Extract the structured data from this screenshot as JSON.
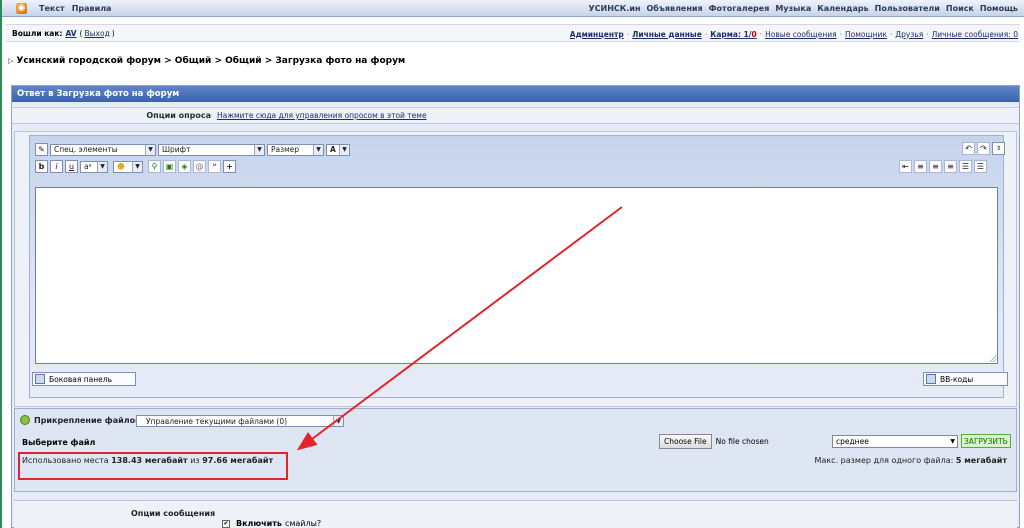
{
  "topnav": {
    "left": [
      "Текст",
      "Правила"
    ],
    "right": [
      "УСИНСК.ин",
      "Объявления",
      "Фотогалерея",
      "Музыка",
      "Календарь",
      "Пользователи",
      "Поиск",
      "Помощь"
    ]
  },
  "userbar": {
    "logged_in_label": "Вошли как:",
    "username": "AV",
    "logout_open": "(",
    "logout": "Выход",
    "logout_close": ")",
    "links": {
      "admin": "Админцентр",
      "profile": "Личные данные",
      "karma_label": "Карма:",
      "karma_pos": "1",
      "karma_slash": "/",
      "karma_neg": "0",
      "new_messages": "Новые сообщения",
      "assistant": "Помощник",
      "friends": "Друзья",
      "pm": "Личные сообщения: 0"
    },
    "separator": "·"
  },
  "breadcrumb": "Усинский городской форум > Общий > Общий > Загрузка фото на форум",
  "form": {
    "header": "Ответ в Загрузка фото на форум",
    "poll": {
      "label": "Опции опроса",
      "link": "Нажмите сюда для управления опросом в этой теме"
    },
    "editor": {
      "special": "Спец. элементы",
      "font": "Шрифт",
      "size": "Размер",
      "side_panel": "Боковая панель",
      "bbcodes": "BB-коды"
    },
    "attach": {
      "title": "Прикрепление файлов",
      "manage": "Управление текущими файлами (0)",
      "choose_label": "Выберите файл",
      "usage_prefix": "Использовано места",
      "used": "138.43 мегабайт",
      "usage_middle": "из",
      "total": "97.66 мегабайт",
      "choose_button": "Choose File",
      "no_file": "No file chosen",
      "size_option": "среднее",
      "upload": "ЗАГРУЗИТЬ",
      "max_prefix": "Макс. размер для одного файла:",
      "max_value": "5 мегабайт"
    },
    "options": {
      "title": "Опции сообщения",
      "enable": "Включить",
      "smilies": "смайлы?"
    }
  },
  "colors": {
    "header_blue": "#3a62aa",
    "annotation_red": "#e0262b",
    "upload_green": "#176b00"
  }
}
